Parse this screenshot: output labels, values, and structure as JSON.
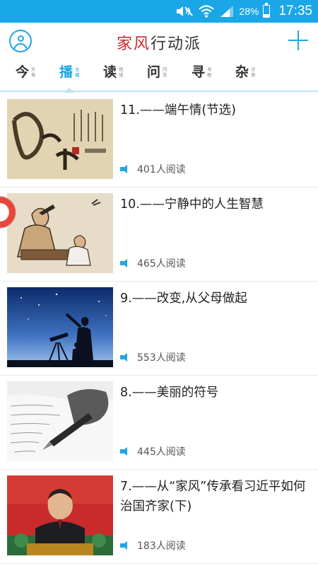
{
  "status_bar": {
    "battery_percent": "28%",
    "battery_level": 0.28,
    "time": "17:35",
    "icons": [
      "mute-icon",
      "wifi-icon",
      "signal-icon",
      "battery-icon"
    ]
  },
  "header": {
    "title_part1": "家风",
    "title_part2": "行动派",
    "left_icon": "profile-icon",
    "right_icon": "add-icon"
  },
  "tabs": [
    {
      "label": "今",
      "sub": "头条",
      "active": false
    },
    {
      "label": "播",
      "sub": "主播",
      "active": true
    },
    {
      "label": "读",
      "sub": "悦读",
      "active": false
    },
    {
      "label": "问",
      "sub": "问答",
      "active": false
    },
    {
      "label": "寻",
      "sub": "寻根",
      "active": false
    },
    {
      "label": "杂",
      "sub": "分类",
      "active": false
    }
  ],
  "articles": [
    {
      "title": "11.——端午情(节选)",
      "reads": "401人阅读",
      "image": "dragon-boat-festival-calligraphy"
    },
    {
      "title": "10.——宁静中的人生智慧",
      "reads": "465人阅读",
      "image": "ancient-scholars-painting"
    },
    {
      "title": "9.——改变,从父母做起",
      "reads": "553人阅读",
      "image": "stargazing-silhouette"
    },
    {
      "title": "8.——美丽的符号",
      "reads": "445人阅读",
      "image": "pen-writing-paper"
    },
    {
      "title": "7.——从“家风”传承看习近平如何治国齐家(下)",
      "reads": "183人阅读",
      "image": "speaker-at-podium"
    }
  ],
  "colors": {
    "accent": "#1fa6e3",
    "status_bar": "#19a7e8",
    "brand_red": "#c8262d",
    "float_ring": "#e8463b"
  }
}
